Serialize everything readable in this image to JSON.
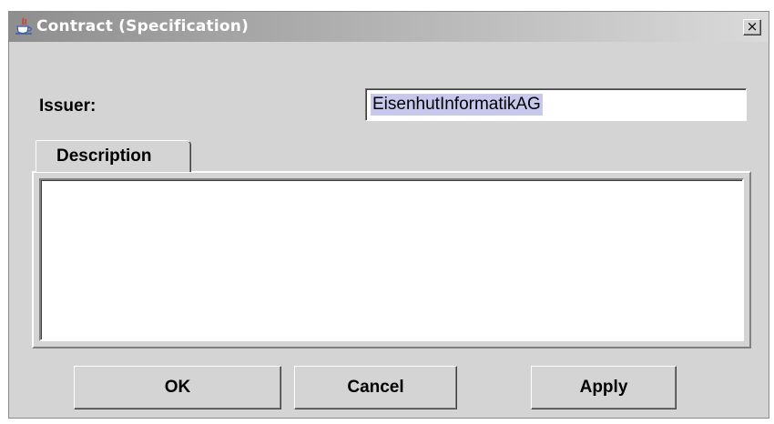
{
  "window": {
    "title": "Contract (Specification)",
    "app_icon": "java-coffee-cup-icon",
    "close_glyph": "×",
    "close_icon": "close-icon"
  },
  "form": {
    "issuer_label": "Issuer:",
    "issuer_value": "EisenhutInformatikAG"
  },
  "tabs": [
    {
      "label": "Description",
      "selected": true
    }
  ],
  "description": {
    "value": ""
  },
  "buttons": {
    "ok": "OK",
    "cancel": "Cancel",
    "apply": "Apply"
  },
  "colors": {
    "dialog_bg": "#d4d4d4",
    "selection": "#c8c8ee"
  }
}
